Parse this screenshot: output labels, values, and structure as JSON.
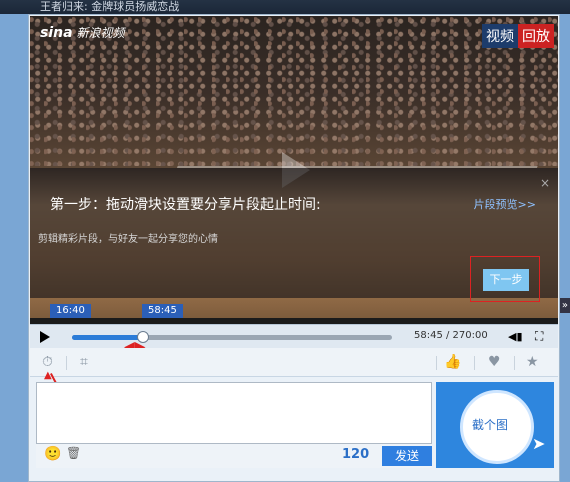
{
  "topbar": {
    "text": "王者归来: 金牌球员扬威恋战"
  },
  "video": {
    "brand_logo": "sina",
    "brand_text": "新浪视频",
    "replay_badge": [
      "视频",
      "回放"
    ],
    "overlay": {
      "title": "第一步：拖动滑块设置要分享片段起止时间:",
      "subtitle": "剪辑精彩片段，与好友一起分享您的心情",
      "preview_link": "片段预览>>",
      "next_button": "下一步",
      "close_icon": "×"
    },
    "clip_start": "16:40",
    "clip_end": "58:45"
  },
  "controls": {
    "time_readout": "58:45 / 270:00",
    "progress_fraction": 0.22
  },
  "composer": {
    "placeholder": "",
    "remaining": "120",
    "send_label": "发送",
    "screenshot_label": "截个图"
  },
  "colors": {
    "accent": "#2e86de",
    "highlight": "#dd2222"
  }
}
